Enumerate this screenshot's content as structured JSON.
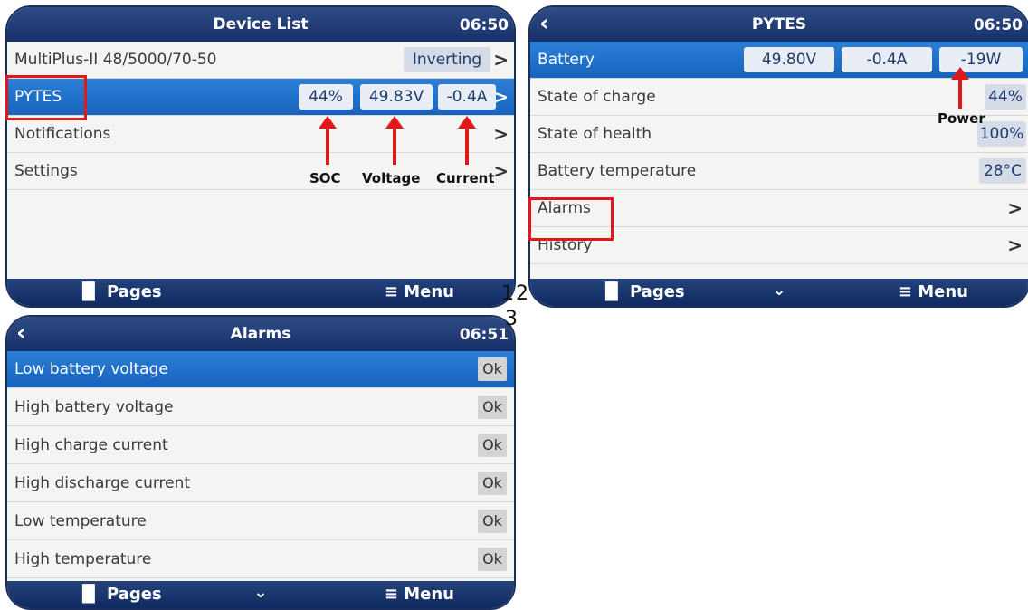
{
  "screen1": {
    "title": "Device List",
    "time": "06:50",
    "rows": [
      {
        "label": "MultiPlus-II 48/5000/70-50",
        "status": "Inverting"
      },
      {
        "label": "PYTES",
        "soc": "44%",
        "voltage": "49.83V",
        "current": "-0.4A"
      },
      {
        "label": "Notifications"
      },
      {
        "label": "Settings"
      }
    ],
    "annotations": {
      "soc": "SOC",
      "voltage": "Voltage",
      "current": "Current"
    },
    "footer": {
      "pages": "Pages",
      "menu": "Menu"
    }
  },
  "screen2": {
    "title": "PYTES",
    "time": "06:50",
    "battery": {
      "label": "Battery",
      "voltage": "49.80V",
      "current": "-0.4A",
      "power": "-19W"
    },
    "rows": [
      {
        "label": "State of charge",
        "value": "44%"
      },
      {
        "label": "State of health",
        "value": "100%"
      },
      {
        "label": "Battery temperature",
        "value": "28°C"
      },
      {
        "label": "Alarms"
      },
      {
        "label": "History"
      }
    ],
    "annotations": {
      "power": "Power"
    },
    "footer": {
      "pages": "Pages",
      "menu": "Menu"
    }
  },
  "screen3": {
    "title": "Alarms",
    "time": "06:51",
    "rows": [
      {
        "label": "Low battery voltage",
        "value": "Ok"
      },
      {
        "label": "High battery voltage",
        "value": "Ok"
      },
      {
        "label": "High charge current",
        "value": "Ok"
      },
      {
        "label": "High discharge current",
        "value": "Ok"
      },
      {
        "label": "Low temperature",
        "value": "Ok"
      },
      {
        "label": "High temperature",
        "value": "Ok"
      }
    ],
    "footer": {
      "pages": "Pages",
      "menu": "Menu"
    }
  },
  "labels": {
    "n1": "1",
    "n2": "2",
    "n3": "3"
  },
  "icons": {
    "pages": "bar-chart-icon",
    "menu": "hamburger-menu-icon",
    "back": "chevron-left-icon",
    "arrow": "chevron-right-icon"
  },
  "colors": {
    "header": "#16306a",
    "selected": "#1663bd",
    "highlight": "#e01818"
  }
}
